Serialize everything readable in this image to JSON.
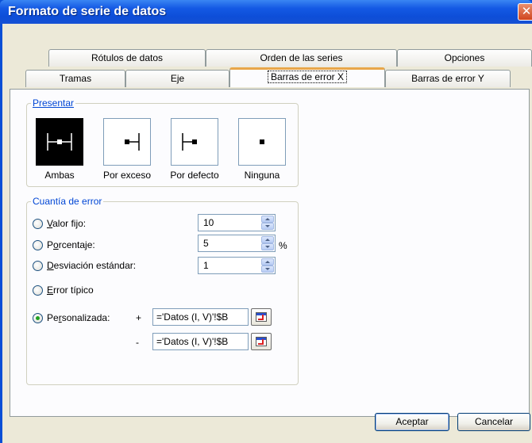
{
  "window": {
    "title": "Formato de serie de datos",
    "close_glyph": "✕"
  },
  "tabs": {
    "row1": [
      "Rótulos de datos",
      "Orden de las series",
      "Opciones"
    ],
    "row2": [
      "Tramas",
      "Eje",
      "Barras de error X",
      "Barras de error Y"
    ],
    "active": "Barras de error X"
  },
  "presentar": {
    "legend": "Presentar",
    "options": [
      {
        "label": "Ambas",
        "icon": "error-bar-both-icon",
        "selected": true
      },
      {
        "label": "Por exceso",
        "icon": "error-bar-plus-icon",
        "selected": false
      },
      {
        "label": "Por defecto",
        "icon": "error-bar-minus-icon",
        "selected": false
      },
      {
        "label": "Ninguna",
        "icon": "error-bar-none-icon",
        "selected": false
      }
    ]
  },
  "cuantia": {
    "legend": "Cuantía de error",
    "valor_fijo": {
      "label_u": "V",
      "label_rest": "alor fijo:",
      "value": "10"
    },
    "porcentaje": {
      "label_pre": "P",
      "label_u": "o",
      "label_rest": "rcentaje:",
      "value": "5",
      "unit": "%"
    },
    "desviacion": {
      "label_u": "D",
      "label_rest": "esviación estándar:",
      "value": "1"
    },
    "error_tipico": {
      "label_u": "E",
      "label_rest": "rror típico"
    },
    "personalizada": {
      "label_pre": "Pe",
      "label_u": "r",
      "label_rest": "sonalizada:",
      "checked": true
    },
    "plus_sign": "+",
    "minus_sign": "-",
    "plus_ref": "='Datos (I, V)'!$B",
    "minus_ref": "='Datos (I, V)'!$B"
  },
  "buttons": {
    "ok": "Aceptar",
    "cancel": "Cancelar"
  },
  "colors": {
    "titlebar": "#0d4ed8",
    "dialog_bg": "#ece9d8",
    "active_tab_accent": "#e8a64a",
    "legend_text": "#0046d5"
  }
}
